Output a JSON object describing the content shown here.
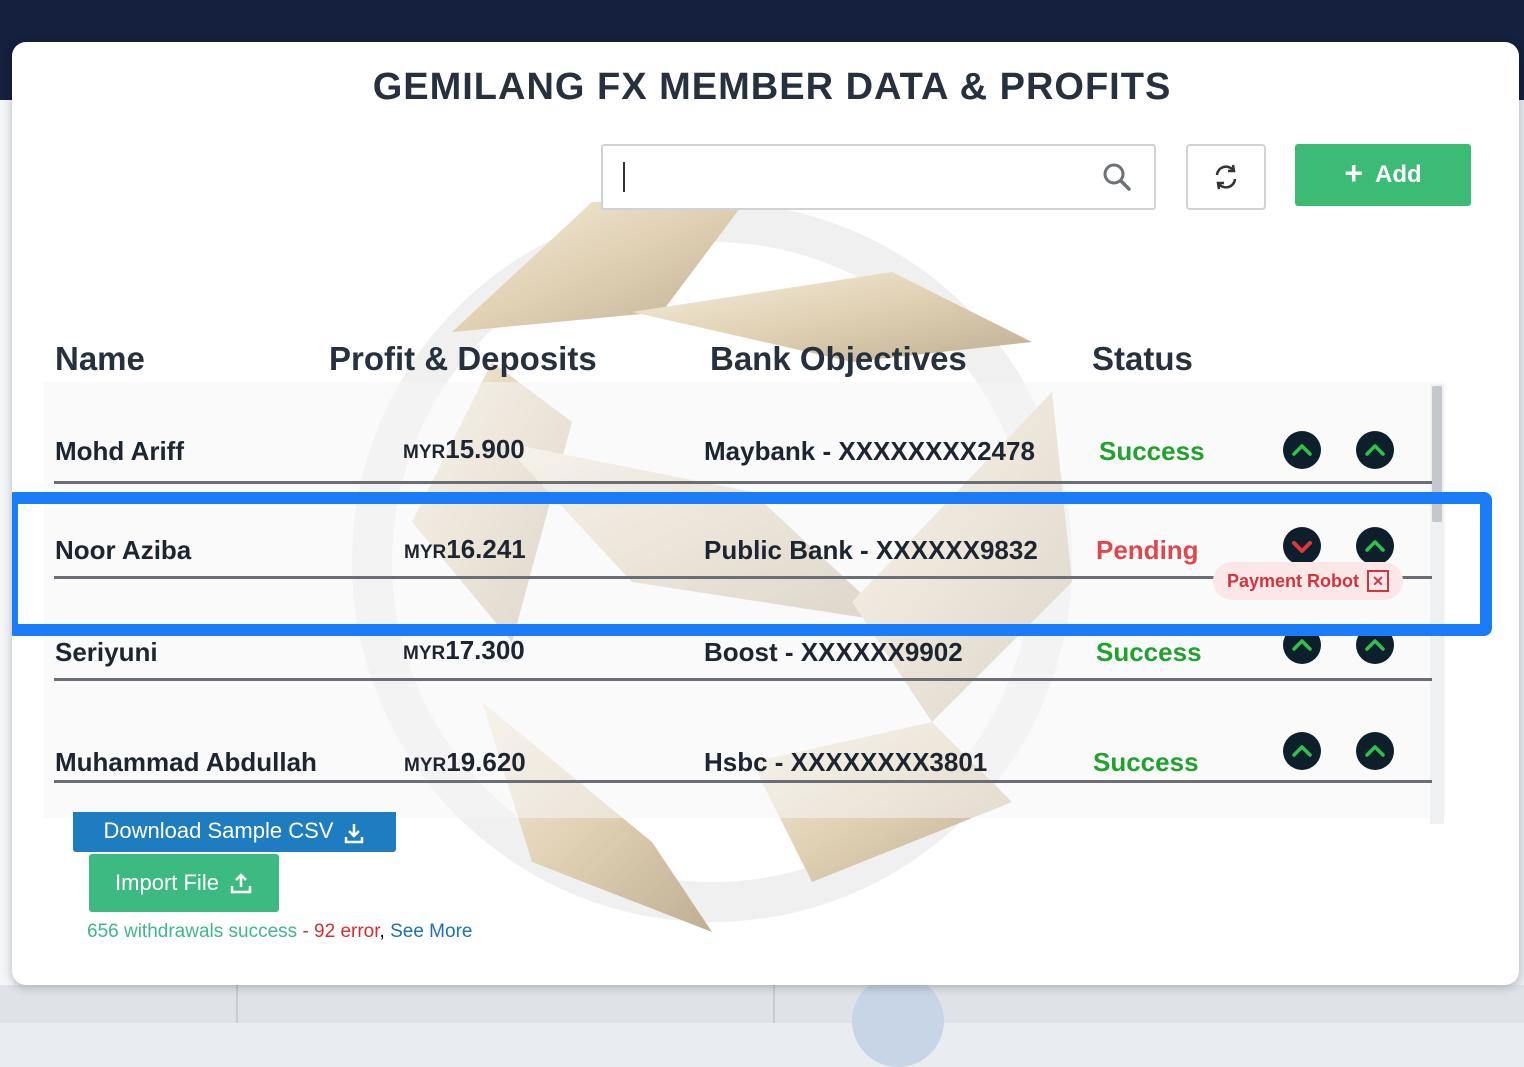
{
  "page": {
    "title": "GEMILANG FX MEMBER DATA & PROFITS"
  },
  "search": {
    "value": "",
    "placeholder": ""
  },
  "toolbar": {
    "add_label": "Add"
  },
  "table": {
    "headers": [
      "Name",
      "Profit & Deposits",
      "Bank Objectives",
      "Status"
    ],
    "rows": [
      {
        "name": "Mohd Ariff",
        "currency": "MYR",
        "amount": "15.900",
        "bank": "Maybank - XXXXXXXX2478",
        "status": "Success",
        "action1": "up",
        "action2": "up"
      },
      {
        "name": "Noor Aziba",
        "currency": "MYR",
        "amount": "16.241",
        "bank": "Public Bank - XXXXXX9832",
        "status": "Pending",
        "action1": "down",
        "action2": "up",
        "tag": "Payment Robot"
      },
      {
        "name": "Seriyuni",
        "currency": "MYR",
        "amount": "17.300",
        "bank": "Boost - XXXXXX9902",
        "status": "Success",
        "action1": "up",
        "action2": "up"
      },
      {
        "name": "Muhammad Abdullah",
        "currency": "MYR",
        "amount": "19.620",
        "bank": "Hsbc - XXXXXXXX3801",
        "status": "Success",
        "action1": "up",
        "action2": "up"
      }
    ]
  },
  "actions": {
    "download_label": "Download Sample CSV",
    "import_label": "Import File"
  },
  "summary": {
    "success_text": "656 withdrawals success",
    "error_text": "- 92 error",
    "separator": ",",
    "link_text": "See More"
  },
  "colors": {
    "accent_green": "#3bbb73",
    "success": "#21a12d",
    "pending": "#e0474c",
    "highlight": "#1a7cf7",
    "topbar": "#14203d"
  }
}
